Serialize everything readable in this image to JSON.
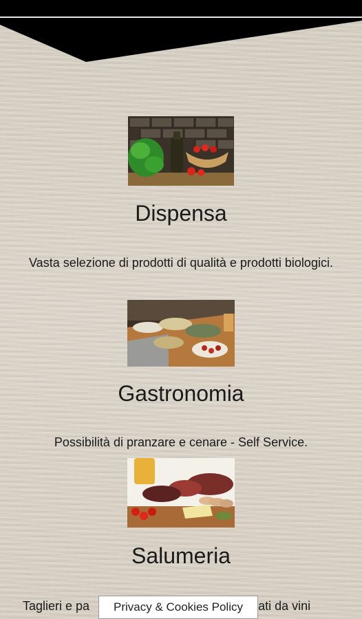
{
  "sections": [
    {
      "title": "Dispensa",
      "description": "Vasta selezione di prodotti di qualità e prodotti biologici.",
      "image": "pantry-photo"
    },
    {
      "title": "Gastronomia",
      "description": "Possibilità di pranzare e cenare - Self Service.",
      "image": "buffet-photo"
    },
    {
      "title": "Salumeria",
      "description": "Taglieri e pa",
      "description_tail": "nati da vini",
      "image": "cured-meats-photo"
    }
  ],
  "cookie_bar": {
    "label": "Privacy & Cookies Policy"
  },
  "colors": {
    "topbar": "#000000",
    "text": "#1a1a1a",
    "background": "#d9d2c6"
  }
}
